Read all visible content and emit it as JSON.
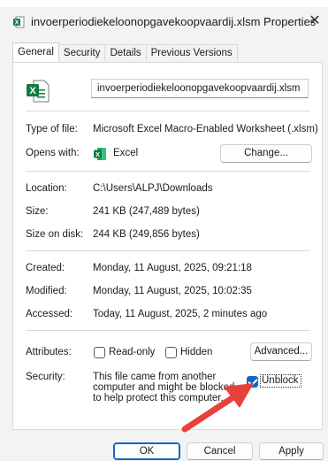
{
  "window": {
    "title": "invoerperiodiekeloonopgavekoopvaardij.xlsm Properties",
    "close_glyph": "✕"
  },
  "tabs": [
    {
      "label": "General",
      "active": true
    },
    {
      "label": "Security",
      "active": false
    },
    {
      "label": "Details",
      "active": false
    },
    {
      "label": "Previous Versions",
      "active": false
    }
  ],
  "general": {
    "filename": "invoerperiodiekeloonopgavekoopvaardij.xlsm",
    "type_label": "Type of file:",
    "type_value": "Microsoft Excel Macro-Enabled Worksheet (.xlsm)",
    "opens_label": "Opens with:",
    "opens_value": "Excel",
    "change_button": "Change...",
    "location_label": "Location:",
    "location_value": "C:\\Users\\ALPJ\\Downloads",
    "size_label": "Size:",
    "size_value": "241 KB (247,489 bytes)",
    "size_on_disk_label": "Size on disk:",
    "size_on_disk_value": "244 KB (249,856 bytes)",
    "created_label": "Created:",
    "created_value": "Monday, 11 August, 2025, 09:21:18",
    "modified_label": "Modified:",
    "modified_value": "Monday, 11 August, 2025, 10:02:35",
    "accessed_label": "Accessed:",
    "accessed_value": "Today, 11 August, 2025, 2 minutes ago",
    "attributes_label": "Attributes:",
    "readonly_label": "Read-only",
    "readonly_checked": false,
    "hidden_label": "Hidden",
    "hidden_checked": false,
    "advanced_button": "Advanced...",
    "security_label": "Security:",
    "security_text": "This file came from another computer and might be blocked to help protect this computer.",
    "unblock_label": "Unblock",
    "unblock_checked": true
  },
  "footer": {
    "ok_button": "OK",
    "cancel_button": "Cancel",
    "apply_button": "Apply"
  },
  "colors": {
    "excel_green": "#107c41",
    "checkbox_blue": "#1467c4",
    "arrow_red": "#e8413a"
  },
  "icons": {
    "title": "excel-file-icon",
    "file": "excel-file-icon",
    "app": "excel-app-icon",
    "close": "close-icon",
    "annotation": "red-arrow-annotation"
  }
}
